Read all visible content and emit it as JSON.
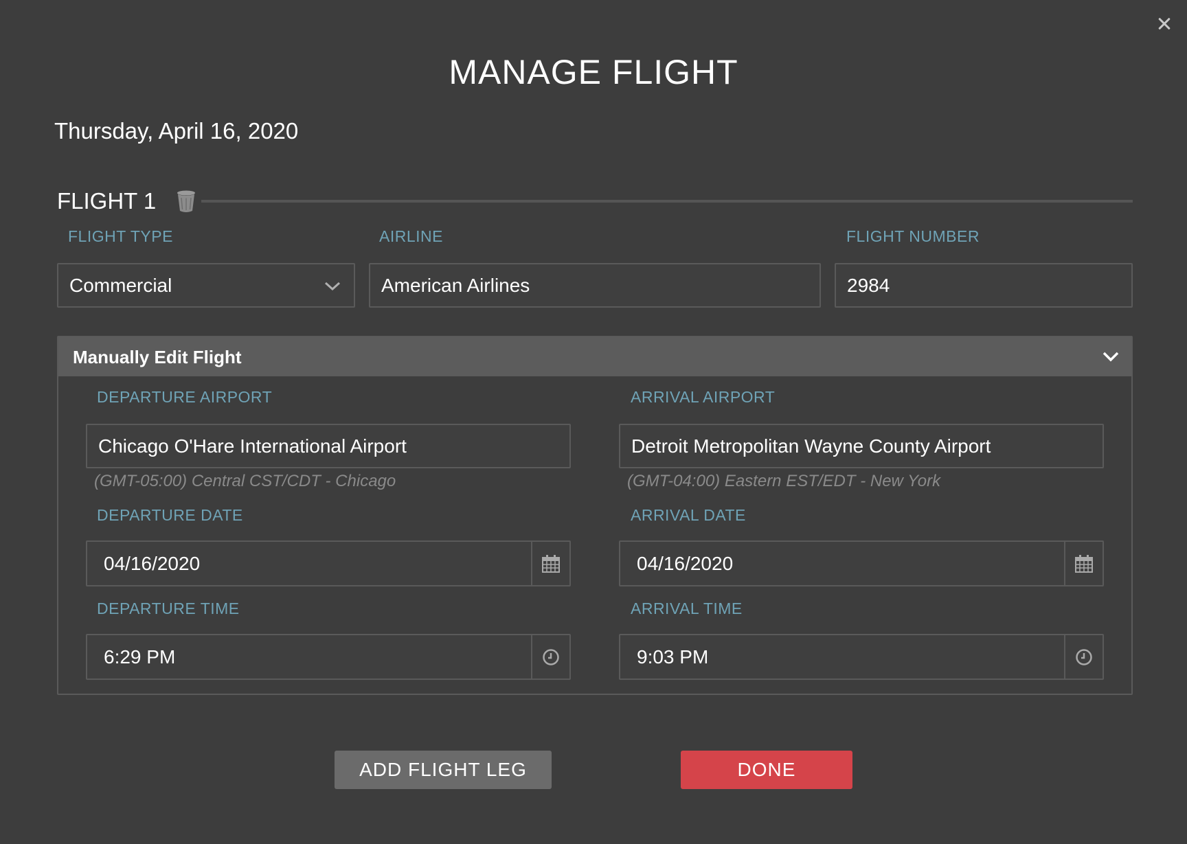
{
  "modal": {
    "title": "MANAGE FLIGHT",
    "date": "Thursday, April 16, 2020"
  },
  "flight": {
    "label": "FLIGHT 1",
    "flight_type_label": "FLIGHT TYPE",
    "flight_type_value": "Commercial",
    "airline_label": "AIRLINE",
    "airline_value": "American Airlines",
    "flight_number_label": "FLIGHT NUMBER",
    "flight_number_value": "2984"
  },
  "manual_edit": {
    "title": "Manually Edit Flight",
    "departure_airport_label": "DEPARTURE AIRPORT",
    "departure_airport_value": "Chicago O'Hare International Airport",
    "departure_timezone": "(GMT-05:00) Central CST/CDT - Chicago",
    "arrival_airport_label": "ARRIVAL AIRPORT",
    "arrival_airport_value": "Detroit Metropolitan Wayne County Airport",
    "arrival_timezone": "(GMT-04:00) Eastern EST/EDT - New York",
    "departure_date_label": "DEPARTURE DATE",
    "departure_date_value": "04/16/2020",
    "arrival_date_label": "ARRIVAL DATE",
    "arrival_date_value": "04/16/2020",
    "departure_time_label": "DEPARTURE TIME",
    "departure_time_value": "6:29 PM",
    "arrival_time_label": "ARRIVAL TIME",
    "arrival_time_value": "9:03 PM"
  },
  "actions": {
    "add_leg": "ADD FLIGHT LEG",
    "done": "DONE"
  },
  "icons": {
    "close": "close-icon",
    "trash": "trash-icon",
    "select_chevron": "chevron-down-icon",
    "panel_chevron": "chevron-down-icon",
    "calendar": "calendar-icon",
    "clock": "clock-icon"
  },
  "colors": {
    "background": "#3d3d3d",
    "label_accent": "#6fa3b6",
    "primary_button": "#d5444a",
    "secondary_button": "#6b6b6b",
    "panel_header": "#5c5c5c"
  }
}
